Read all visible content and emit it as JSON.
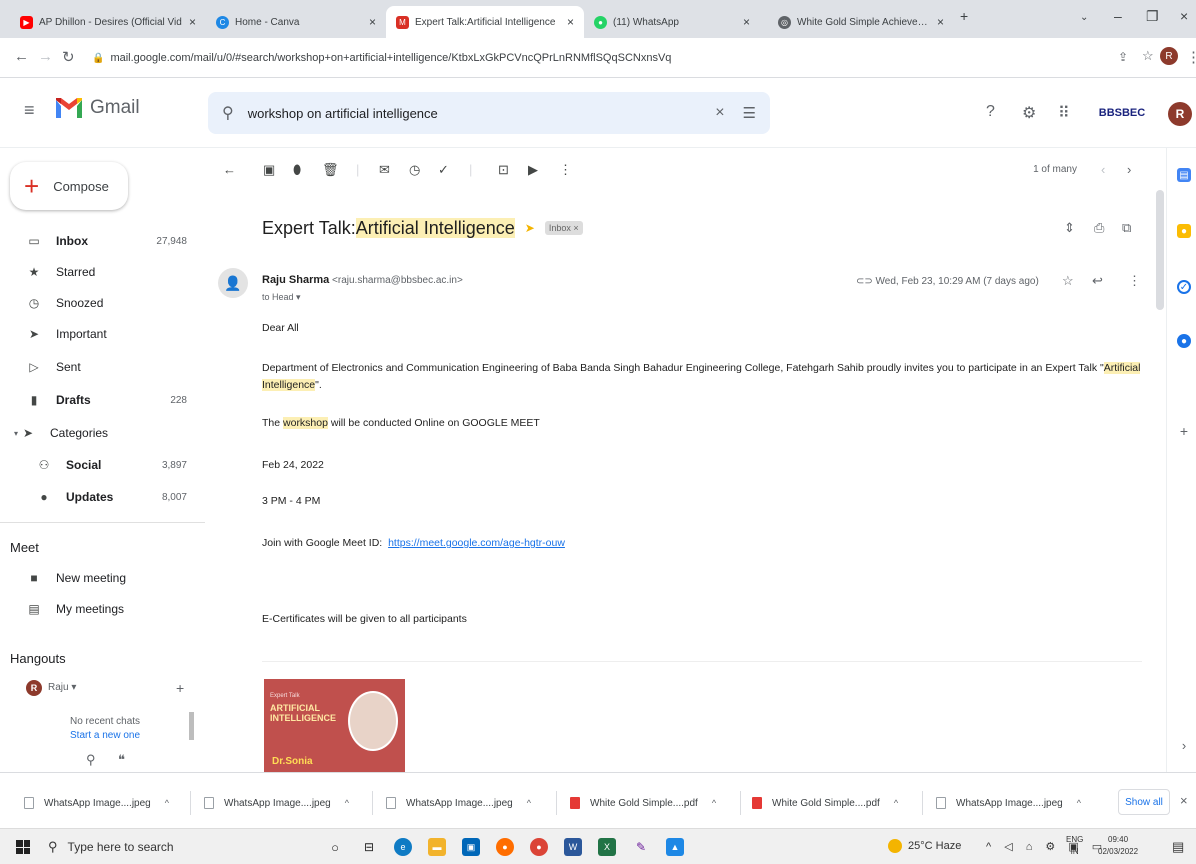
{
  "browser": {
    "tabs": [
      {
        "label": "AP Dhillon - Desires (Official Vid",
        "favicon_color": "#ff0000",
        "active": false
      },
      {
        "label": "Home - Canva",
        "favicon_color": "#1e88e5",
        "active": false
      },
      {
        "label": "Expert Talk:Artificial Intelligence",
        "favicon_color": "#d93025",
        "active": true
      },
      {
        "label": "(11) WhatsApp",
        "favicon_color": "#25d366",
        "active": false
      },
      {
        "label": "White Gold Simple Achievement",
        "favicon_color": "#5f6368",
        "active": false
      }
    ],
    "url": "mail.google.com/mail/u/0/#search/workshop+on+artificial+intelligence/KtbxLxGkPCVncQPrLnRNMflSQqSCNxnsVq"
  },
  "gmail": {
    "app_name": "Gmail",
    "search_value": "workshop on artificial intelligence",
    "org_badge": "BBSBEC",
    "user_initial": "R"
  },
  "sidebar": {
    "compose_label": "Compose",
    "items": [
      {
        "label": "Inbox",
        "count": "27,948",
        "bold": true,
        "icon": "inbox-icon"
      },
      {
        "label": "Starred",
        "count": "",
        "bold": false,
        "icon": "star-icon"
      },
      {
        "label": "Snoozed",
        "count": "",
        "bold": false,
        "icon": "clock-icon"
      },
      {
        "label": "Important",
        "count": "",
        "bold": false,
        "icon": "important-icon"
      },
      {
        "label": "Sent",
        "count": "",
        "bold": false,
        "icon": "send-icon"
      },
      {
        "label": "Drafts",
        "count": "228",
        "bold": true,
        "icon": "draft-icon"
      },
      {
        "label": "Categories",
        "count": "",
        "bold": false,
        "icon": "label-icon"
      },
      {
        "label": "Social",
        "count": "3,897",
        "bold": true,
        "icon": "people-icon"
      },
      {
        "label": "Updates",
        "count": "8,007",
        "bold": true,
        "icon": "info-icon"
      }
    ],
    "meet_title": "Meet",
    "meet_items": [
      "New meeting",
      "My meetings"
    ],
    "hangouts_title": "Hangouts",
    "hangouts_user": "Raju",
    "hangouts_user_initial": "R",
    "no_chats": "No recent chats",
    "start_new": "Start a new one"
  },
  "toolbar": {
    "pager": "1 of many"
  },
  "email": {
    "subject_prefix": "Expert Talk:",
    "subject_highlight": "Artificial Intelligence",
    "label_chip": "Inbox ×",
    "sender_name": "Raju Sharma",
    "sender_email": "<raju.sharma@bbsbec.ac.in>",
    "to_line": "to Head ▾",
    "date": "Wed, Feb 23, 10:29 AM (7 days ago)",
    "greeting": "Dear All",
    "para1": "Department of Electronics and Communication Engineering of Baba Banda Singh Bahadur Engineering College, Fatehgarh Sahib proudly invites you to participate in an Expert Talk \"",
    "para1_hl1": "Artificial",
    "para1_hl2": "Intelligence",
    "para1_end": "\".",
    "para2_pre": "The ",
    "para2_hl": "workshop",
    "para2_post": " will be conducted Online on GOOGLE MEET",
    "event_date": "Feb 24, 2022",
    "event_time": "3 PM - 4 PM",
    "meet_prefix": "Join with Google Meet ID:",
    "meet_link": "https://meet.google.com/age-hgtr-ouw",
    "certificate": "E-Certificates will be given to all participants",
    "poster": {
      "small": "Expert Talk",
      "title_l1": "ARTIFICIAL",
      "title_l2": "INTELLIGENCE",
      "speaker": "Dr.Sonia"
    }
  },
  "downloads": {
    "items": [
      {
        "label": "WhatsApp Image....jpeg",
        "type": "image"
      },
      {
        "label": "WhatsApp Image....jpeg",
        "type": "image"
      },
      {
        "label": "WhatsApp Image....jpeg",
        "type": "image"
      },
      {
        "label": "White Gold Simple....pdf",
        "type": "pdf"
      },
      {
        "label": "White Gold Simple....pdf",
        "type": "pdf"
      },
      {
        "label": "WhatsApp Image....jpeg",
        "type": "image"
      }
    ],
    "show_all": "Show all"
  },
  "taskbar": {
    "search_placeholder": "Type here to search",
    "weather": "25°C Haze",
    "lang_line1": "ENG",
    "lang_line2": "IN",
    "time": "09:40",
    "date": "02/03/2022"
  }
}
